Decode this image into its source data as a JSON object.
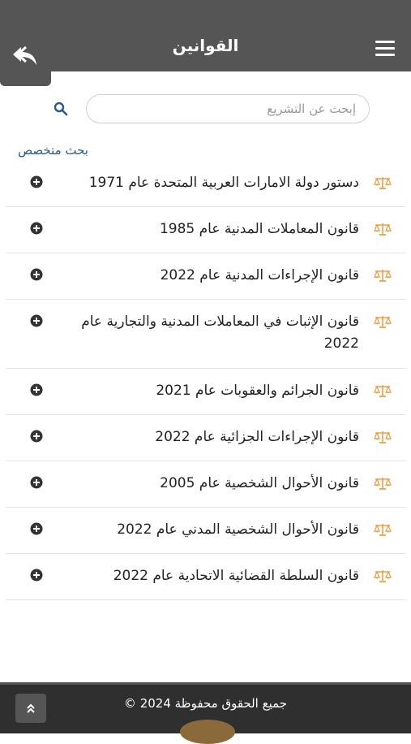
{
  "header": {
    "title": "القوانين",
    "back_icon": "reply-icon",
    "menu_icon": "hamburger-menu-icon"
  },
  "search": {
    "placeholder": "إبحث عن التشريع",
    "value": "",
    "icon": "search-icon"
  },
  "advanced_search_label": "بحث متخصص",
  "laws": [
    {
      "title": "دستور دولة الامارات العربية المتحدة عام 1971"
    },
    {
      "title": "قانون المعاملات المدنية عام 1985"
    },
    {
      "title": "قانون الإجراءات المدنية عام 2022"
    },
    {
      "title": "قانون الإثبات في المعاملات المدنية والتجارية عام 2022"
    },
    {
      "title": "قانون الجرائم والعقوبات عام 2021"
    },
    {
      "title": "قانون الإجراءات الجزائية عام 2022"
    },
    {
      "title": "قانون الأحوال الشخصية عام 2005"
    },
    {
      "title": "قانون الأحوال الشخصية المدني عام 2022"
    },
    {
      "title": "قانون السلطة القضائية الاتحادية عام 2022"
    }
  ],
  "footer": {
    "copyright": "جميع الحقوق محفوظة 2024 ©",
    "scroll_top_icon": "double-chevron-up-icon"
  },
  "colors": {
    "header_bg": "#555555",
    "accent_scale": "#e8a04a",
    "link": "#2a5a8c",
    "footer_bg": "#2f2f2f"
  }
}
